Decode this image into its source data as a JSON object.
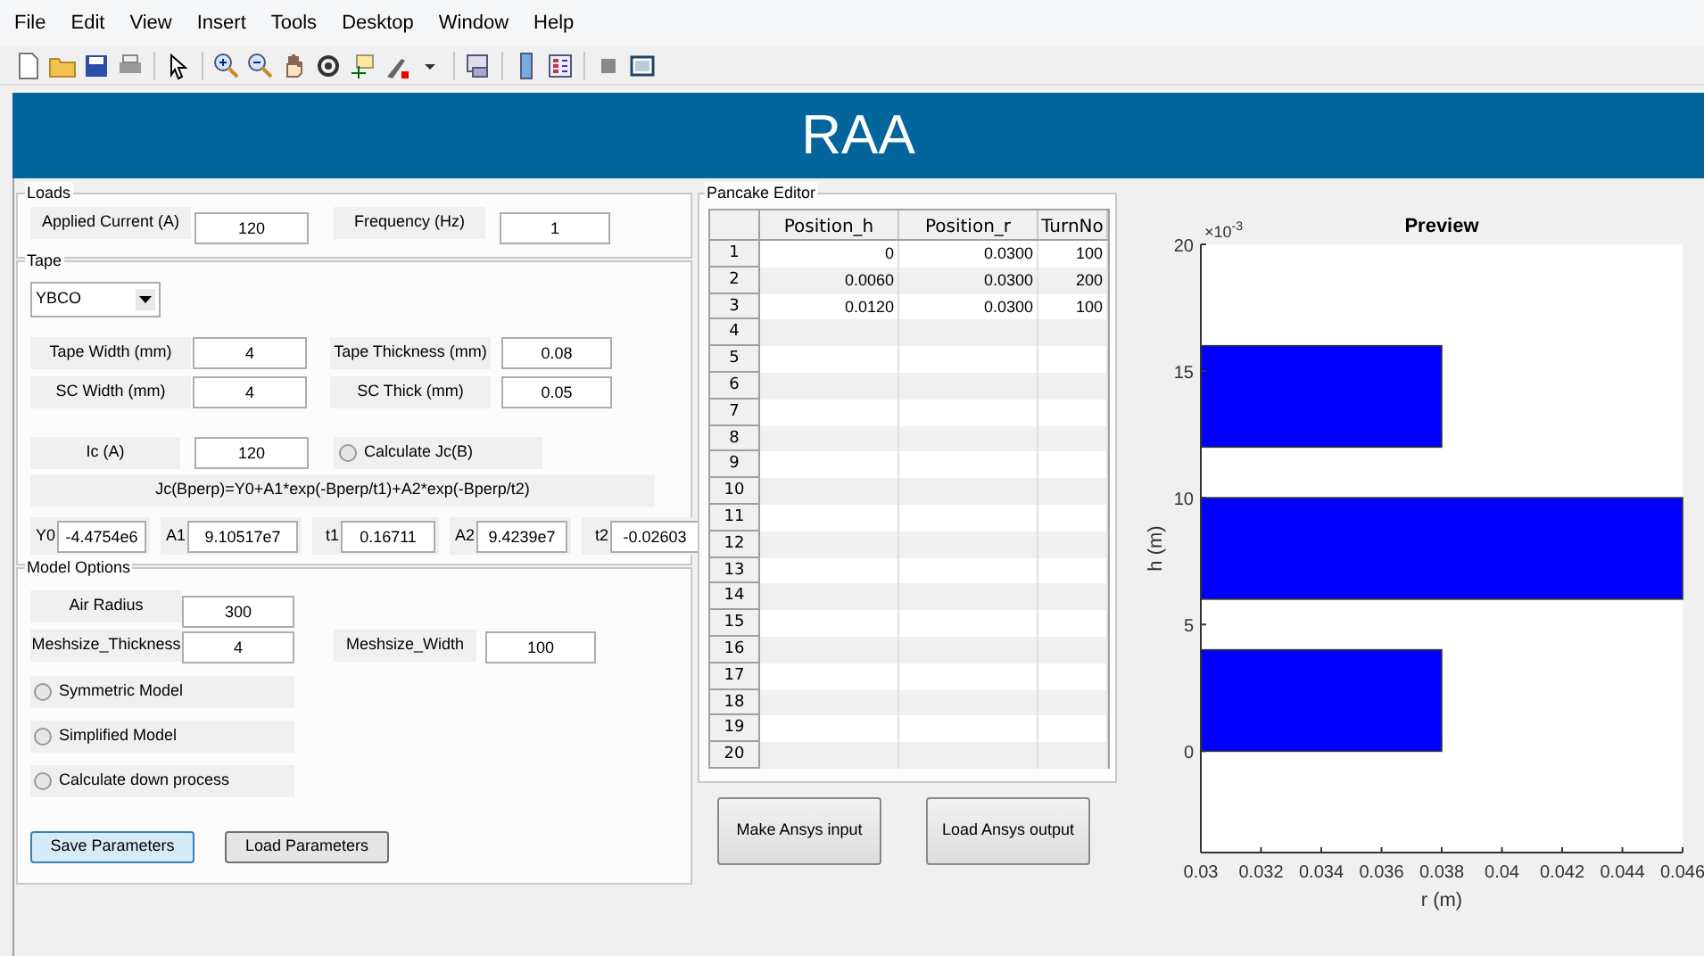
{
  "menu": [
    "File",
    "Edit",
    "View",
    "Insert",
    "Tools",
    "Desktop",
    "Window",
    "Help"
  ],
  "banner": {
    "title": "RAA"
  },
  "loads": {
    "title": "Loads",
    "fields": [
      {
        "label": "Applied Current (A)",
        "value": "120"
      },
      {
        "label": "Frequency (Hz)",
        "value": "1"
      }
    ]
  },
  "tape": {
    "title": "Tape",
    "dropdown": {
      "value": "YBCO"
    },
    "fields": [
      {
        "label": "Tape Width (mm)",
        "value": "4"
      },
      {
        "label": "Tape Thickness (mm)",
        "value": "0.08"
      },
      {
        "label": "SC Width (mm)",
        "value": "4"
      },
      {
        "label": "SC Thick (mm)",
        "value": "0.05"
      }
    ],
    "ic": {
      "label": "Ic (A)",
      "value": "120"
    },
    "calc_jc": {
      "label": "Calculate Jc(B)",
      "checked": false
    },
    "formula": "Jc(Bperp)=Y0+A1*exp(-Bperp/t1)+A2*exp(-Bperp/t2)",
    "coefficients": [
      {
        "label": "Y0",
        "value": "-4.4754e6"
      },
      {
        "label": "A1",
        "value": "9.10517e7"
      },
      {
        "label": "t1",
        "value": "0.16711"
      },
      {
        "label": "A2",
        "value": "9.4239e7"
      },
      {
        "label": "t2",
        "value": "-0.02603"
      }
    ]
  },
  "model_options": {
    "title": "Model Options",
    "fields": [
      {
        "label": "Air Radius",
        "value": "300"
      },
      {
        "label": "Meshsize_Thickness",
        "value": "4"
      },
      {
        "label": "Meshsize_Width",
        "value": "100"
      }
    ],
    "options": [
      {
        "label": "Symmetric Model",
        "checked": false
      },
      {
        "label": "Simplified Model",
        "checked": false
      },
      {
        "label": "Calculate down process",
        "checked": false
      }
    ],
    "buttons": [
      {
        "label": "Save Parameters",
        "focused": true
      },
      {
        "label": "Load Parameters",
        "focused": false
      }
    ]
  },
  "pancake_editor": {
    "title": "Pancake Editor",
    "columns": [
      "Position_h",
      "Position_r",
      "TurnNo"
    ],
    "rows": [
      {
        "number": "1",
        "cells": [
          "0",
          "0.0300",
          "100"
        ]
      },
      {
        "number": "2",
        "cells": [
          "0.0060",
          "0.0300",
          "200"
        ]
      },
      {
        "number": "3",
        "cells": [
          "0.0120",
          "0.0300",
          "100"
        ]
      },
      {
        "number": "4"
      },
      {
        "number": "5"
      },
      {
        "number": "6"
      },
      {
        "number": "7"
      },
      {
        "number": "8"
      },
      {
        "number": "9"
      },
      {
        "number": "10"
      },
      {
        "number": "11"
      },
      {
        "number": "12"
      },
      {
        "number": "13"
      },
      {
        "number": "14"
      },
      {
        "number": "15"
      },
      {
        "number": "16"
      },
      {
        "number": "17"
      },
      {
        "number": "18"
      },
      {
        "number": "19"
      },
      {
        "number": "20"
      }
    ]
  },
  "actions": [
    {
      "label": "Make Ansys input"
    },
    {
      "label": "Load Ansys output"
    }
  ],
  "preview": {
    "chart_data": {
      "type": "bar",
      "orientation": "horizontal",
      "title": "Preview",
      "xlabel": "r (m)",
      "ylabel": "h (m)",
      "x": [
        2,
        8,
        14
      ],
      "series": [
        {
          "color": "#0000ff",
          "values": [
            0.038,
            0.046,
            0.038
          ]
        }
      ],
      "xlim": [
        0.03,
        0.046
      ],
      "ylim": [
        -4,
        20
      ],
      "xticks": [
        0.03,
        0.032,
        0.034,
        0.036,
        0.038,
        0.04,
        0.042,
        0.044,
        0.046
      ],
      "yticks": [
        0,
        5,
        10,
        15,
        20
      ],
      "annotations": [
        "×10",
        "-3"
      ]
    }
  }
}
